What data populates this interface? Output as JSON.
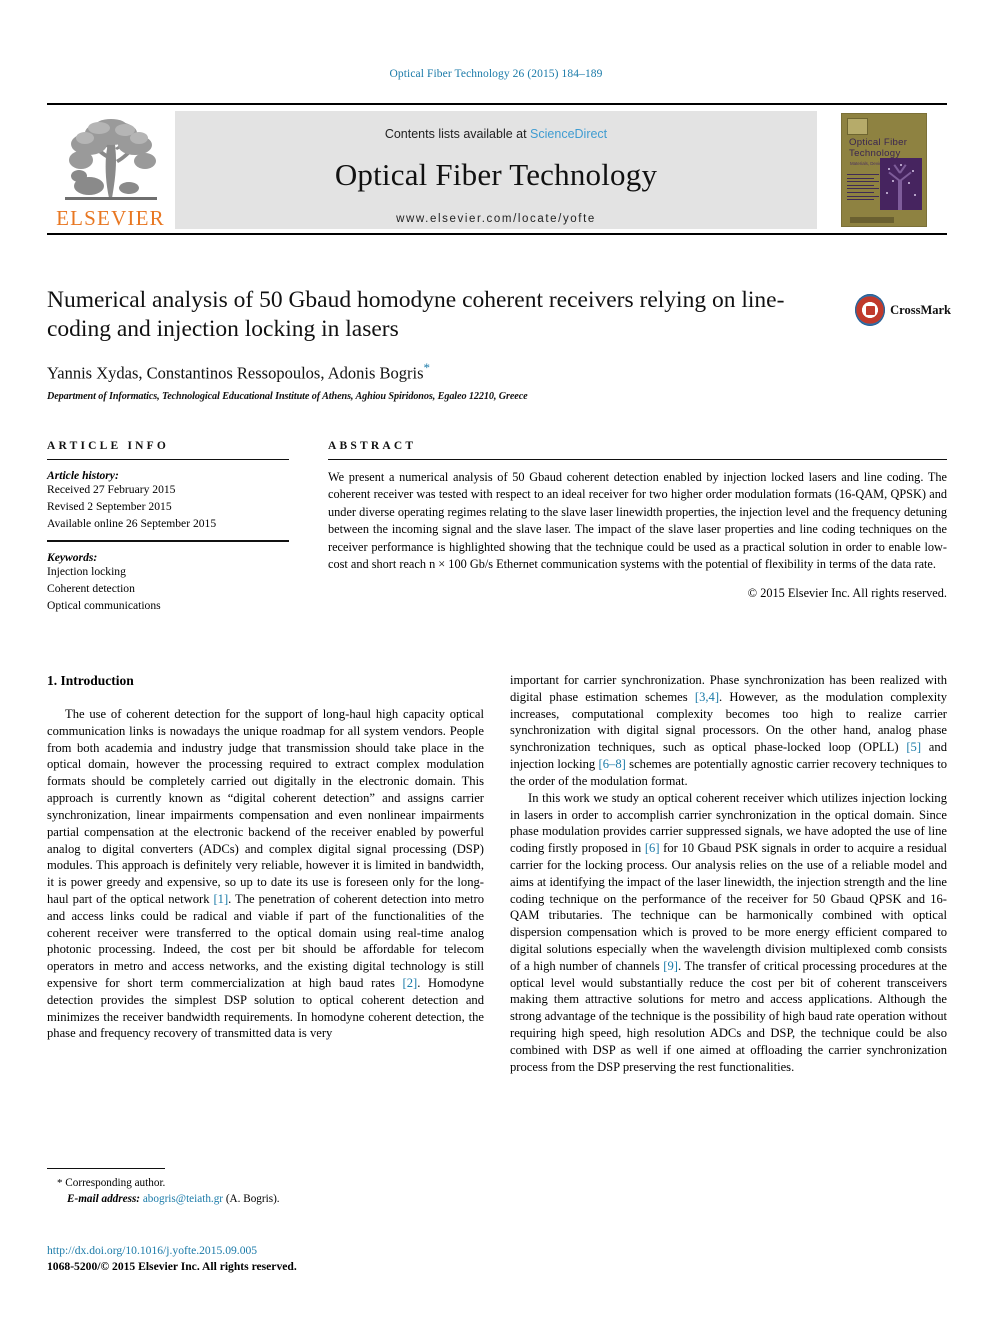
{
  "running_head": "Optical Fiber Technology 26 (2015) 184–189",
  "masthead": {
    "contents_prefix": "Contents lists available at ",
    "sciencedirect": "ScienceDirect",
    "journal_title": "Optical Fiber Technology",
    "journal_url": "www.elsevier.com/locate/yofte",
    "publisher_logo_label": "ELSEVIER",
    "cover": {
      "title_line1": "Optical  Fiber",
      "title_line2": "Technology",
      "subtitle": "Materials, Devices and Systems"
    }
  },
  "article": {
    "title": "Numerical analysis of 50 Gbaud homodyne coherent receivers relying on line-coding and injection locking in lasers",
    "authors": "Yannis Xydas, Constantinos Ressopoulos, Adonis Bogris",
    "corresponding_marker": "*",
    "affiliation": "Department of Informatics, Technological Educational Institute of Athens, Aghiou Spiridonos, Egaleo 12210, Greece",
    "crossmark_label": "CrossMark"
  },
  "article_info": {
    "heading": "ARTICLE INFO",
    "history_label": "Article history:",
    "history": [
      "Received 27 February 2015",
      "Revised 2 September 2015",
      "Available online 26 September 2015"
    ],
    "keywords_label": "Keywords:",
    "keywords": [
      "Injection locking",
      "Coherent detection",
      "Optical communications"
    ]
  },
  "abstract": {
    "heading": "ABSTRACT",
    "text": "We present a numerical analysis of 50 Gbaud coherent detection enabled by injection locked lasers and line coding. The coherent receiver was tested with respect to an ideal receiver for two higher order modulation formats (16-QAM, QPSK) and under diverse operating regimes relating to the slave laser linewidth properties, the injection level and the frequency detuning between the incoming signal and the slave laser. The impact of the slave laser properties and line coding techniques on the receiver performance is highlighted showing that the technique could be used as a practical solution in order to enable low-cost and short reach n × 100 Gb/s Ethernet communication systems with the potential of flexibility in terms of the data rate.",
    "copyright": "© 2015 Elsevier Inc. All rights reserved."
  },
  "body": {
    "section_heading": "1. Introduction",
    "left_p1_a": "The use of coherent detection for the support of long-haul high capacity optical communication links is nowadays the unique roadmap for all system vendors. People from both academia and industry judge that transmission should take place in the optical domain, however the processing required to extract complex modulation formats should be completely carried out digitally in the electronic domain. This approach is currently known as “digital coherent detection” and assigns carrier synchronization, linear impairments compensation and even nonlinear impairments partial compensation at the electronic backend of the receiver enabled by powerful analog to digital converters (ADCs) and complex digital signal processing (DSP) modules. This approach is definitely very reliable, however it is limited in bandwidth, it is power greedy and expensive, so up to date its use is foreseen only for the long-haul part of the optical network ",
    "left_ref1": "[1]",
    "left_p1_b": ". The penetration of coherent detection into metro and access links could be radical and viable if part of the functionalities of the coherent receiver were transferred to the optical domain using real-time analog photonic processing. Indeed, the cost per bit should be affordable for telecom operators in metro and access networks, and the existing digital technology is still expensive for short term commercialization at high baud rates ",
    "left_ref2": "[2]",
    "left_p1_c": ". Homodyne detection provides the simplest DSP solution to optical coherent detection and minimizes the receiver bandwidth requirements. In homodyne coherent detection, the phase and frequency recovery of transmitted data is very",
    "right_p1_a": "important for carrier synchronization. Phase synchronization has been realized with digital phase estimation schemes ",
    "right_ref34": "[3,4]",
    "right_p1_b": ". However, as the modulation complexity increases, computational complexity becomes too high to realize carrier synchronization with digital signal processors. On the other hand, analog phase synchronization techniques, such as optical phase-locked loop (OPLL) ",
    "right_ref5": "[5]",
    "right_p1_c": " and injection locking ",
    "right_ref68": "[6–8]",
    "right_p1_d": " schemes are potentially agnostic carrier recovery techniques to the order of the modulation format.",
    "right_p2_a": "In this work we study an optical coherent receiver which utilizes injection locking in lasers in order to accomplish carrier synchronization in the optical domain. Since phase modulation provides carrier suppressed signals, we have adopted the use of line coding firstly proposed in ",
    "right_ref6": "[6]",
    "right_p2_b": " for 10 Gbaud PSK signals in order to acquire a residual carrier for the locking process. Our analysis relies on the use of a reliable model and aims at identifying the impact of the laser linewidth, the injection strength and the line coding technique on the performance of the receiver for 50 Gbaud QPSK and 16-QAM tributaries. The technique can be harmonically combined with optical dispersion compensation which is proved to be more energy efficient compared to digital solutions especially when the wavelength division multiplexed comb consists of a high number of channels ",
    "right_ref9": "[9]",
    "right_p2_c": ". The transfer of critical processing procedures at the optical level would substantially reduce the cost per bit of coherent transceivers making them attractive solutions for metro and access applications. Although the strong advantage of the technique is the possibility of high baud rate operation without requiring high speed, high resolution ADCs and DSP, the technique could be also combined with DSP as well if one aimed at offloading the carrier synchronization process from the DSP preserving the rest functionalities."
  },
  "footnote": {
    "corresponding": "Corresponding author.",
    "email_label": "E-mail address:",
    "email": "abogris@teiath.gr",
    "email_owner": "(A. Bogris)."
  },
  "footer": {
    "doi": "http://dx.doi.org/10.1016/j.yofte.2015.09.005",
    "issn_line": "1068-5200/© 2015 Elsevier Inc. All rights reserved."
  },
  "colors": {
    "link": "#1a7aa8",
    "sciencedirect": "#3f9cd1",
    "elsevier_orange": "#e87722",
    "band_grey": "#e3e3e3"
  }
}
